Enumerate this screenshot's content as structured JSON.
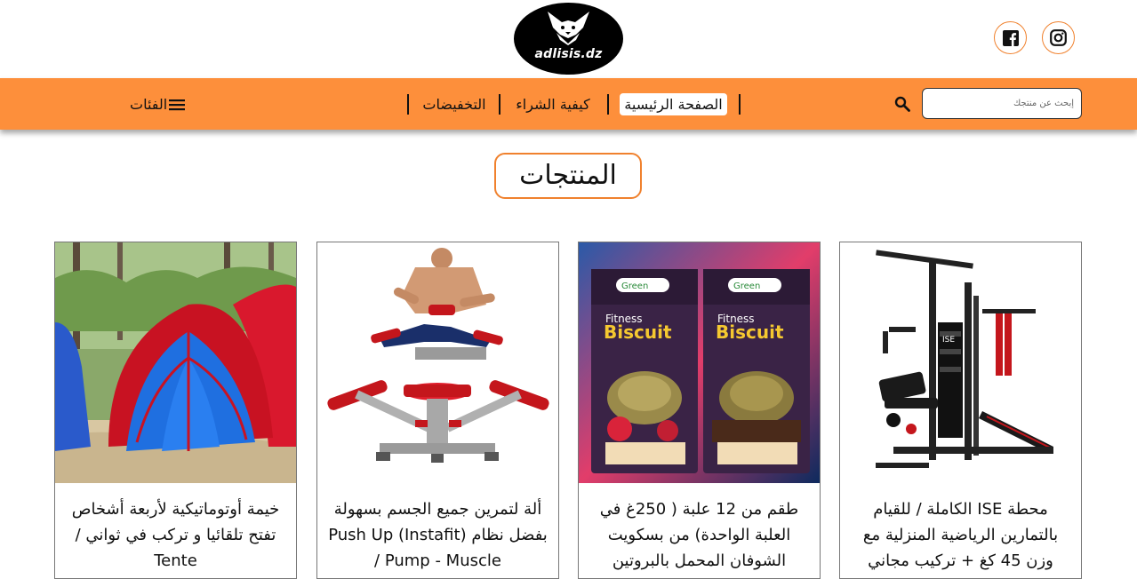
{
  "header": {
    "logo_text": "adlisis.dz",
    "social": [
      {
        "name": "facebook-icon"
      },
      {
        "name": "instagram-icon"
      }
    ]
  },
  "nav": {
    "search_placeholder": "إبحث عن منتجك",
    "items": [
      {
        "label": "الصفحة الرئيسية",
        "active": true
      },
      {
        "label": "كيفية الشراء",
        "active": false
      },
      {
        "label": "التخفيضات",
        "active": false
      }
    ],
    "categories_label": "الفئات"
  },
  "section": {
    "title": "المنتجات"
  },
  "products": [
    {
      "title": "محطة ISE الكاملة / للقيام بالتمارين الرياضية المنزلية مع وزن 45 كغ + تركيب مجاني"
    },
    {
      "title": "طقم من 12 علبة ( 250غ في العلبة الواحدة) من بسكويت الشوفان المحمل بالبروتين"
    },
    {
      "title": "ألة لتمرين جميع الجسم بسهولة بفضل نظام (Instafit) Push Up Pump - Muscle /"
    },
    {
      "title": "خيمة أوتوماتيكية لأربعة أشخاص تفتح تلقائيا و تركب في ثواني / Tente"
    }
  ],
  "colors": {
    "accent": "#fd8f3b",
    "border_accent": "#f0812d"
  }
}
